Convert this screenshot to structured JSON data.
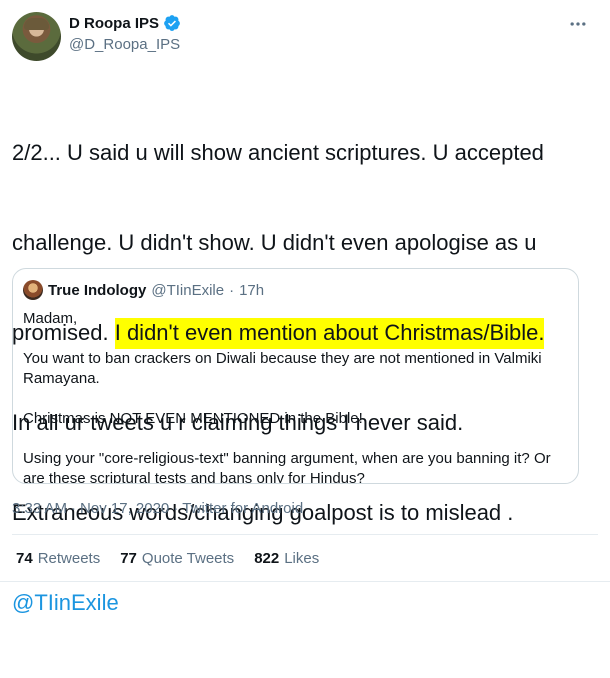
{
  "author": {
    "display_name": "D Roopa IPS",
    "handle": "@D_Roopa_IPS",
    "verified": true,
    "avatar_icon": "user-avatar-photo"
  },
  "header": {
    "more_icon": "more-horizontal-icon"
  },
  "tweet": {
    "line1": "2/2... U said u will show ancient scriptures. U accepted",
    "line2": "challenge. U didn't show. U didn't even apologise as u",
    "line3_plain": "promised. ",
    "line3_highlight": "I didn't even mention about Christmas/Bible.",
    "line4": "In all ur tweets u r claiming things I never said.",
    "line5": "Extraneous words/changing goalpost is to mislead .",
    "mention": "@TIinExile",
    "highlight_color": "#ffff00"
  },
  "quote": {
    "name": "True Indology",
    "handle": "@TIinExile",
    "separator": "·",
    "time": "17h",
    "p1": "Madam,",
    "p2": "You want to ban crackers on Diwali because they are not mentioned in Valmiki Ramayana.",
    "p3": "Christmas is NOT EVEN MENTIONED in the Bible!",
    "p4": "Using your \"core-religious-text\" banning argument, when are you banning it? Or are these scriptural tests and bans only for Hindus? twitter.com/D_Roopa_IPS/st…"
  },
  "meta": {
    "time": "3:33 AM",
    "dot1": "·",
    "date": "Nov 17, 2020",
    "dot2": "·",
    "source": "Twitter for Android"
  },
  "stats": {
    "retweets_count": "74",
    "retweets_label": "Retweets",
    "quotes_count": "77",
    "quotes_label": "Quote Tweets",
    "likes_count": "822",
    "likes_label": "Likes"
  },
  "colors": {
    "link": "#1b95e0",
    "secondary_text": "#5b7083",
    "verified": "#1da1f2"
  }
}
